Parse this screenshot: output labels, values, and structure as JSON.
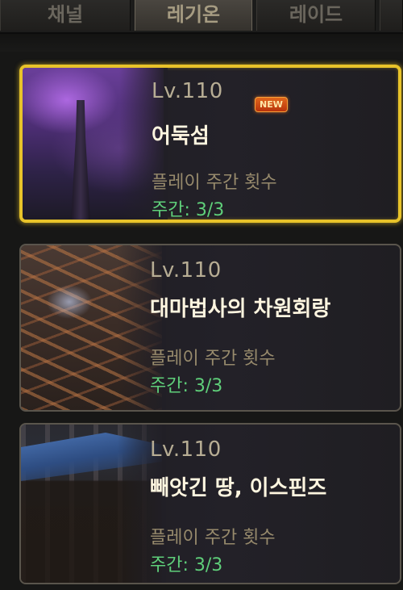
{
  "tabs": [
    {
      "label": "채널",
      "active": false
    },
    {
      "label": "레기온",
      "active": true
    },
    {
      "label": "레이드",
      "active": false
    },
    {
      "label": "",
      "active": false
    }
  ],
  "colors": {
    "selected_border": "#e8c32a",
    "weekly_text": "#5fcf7a",
    "name_text": "#fff6e0",
    "level_text": "#b7ad94"
  },
  "dungeons": [
    {
      "level": "Lv.110",
      "badge": "NEW",
      "name": "어둑섬",
      "plays_label": "플레이 주간 횟수",
      "weekly": "주간: 3/3",
      "selected": true
    },
    {
      "level": "Lv.110",
      "name": "대마법사의 차원회랑",
      "plays_label": "플레이 주간 횟수",
      "weekly": "주간: 3/3",
      "selected": false
    },
    {
      "level": "Lv.110",
      "name": "빼앗긴 땅, 이스핀즈",
      "plays_label": "플레이 주간 횟수",
      "weekly": "주간: 3/3",
      "selected": false
    }
  ]
}
